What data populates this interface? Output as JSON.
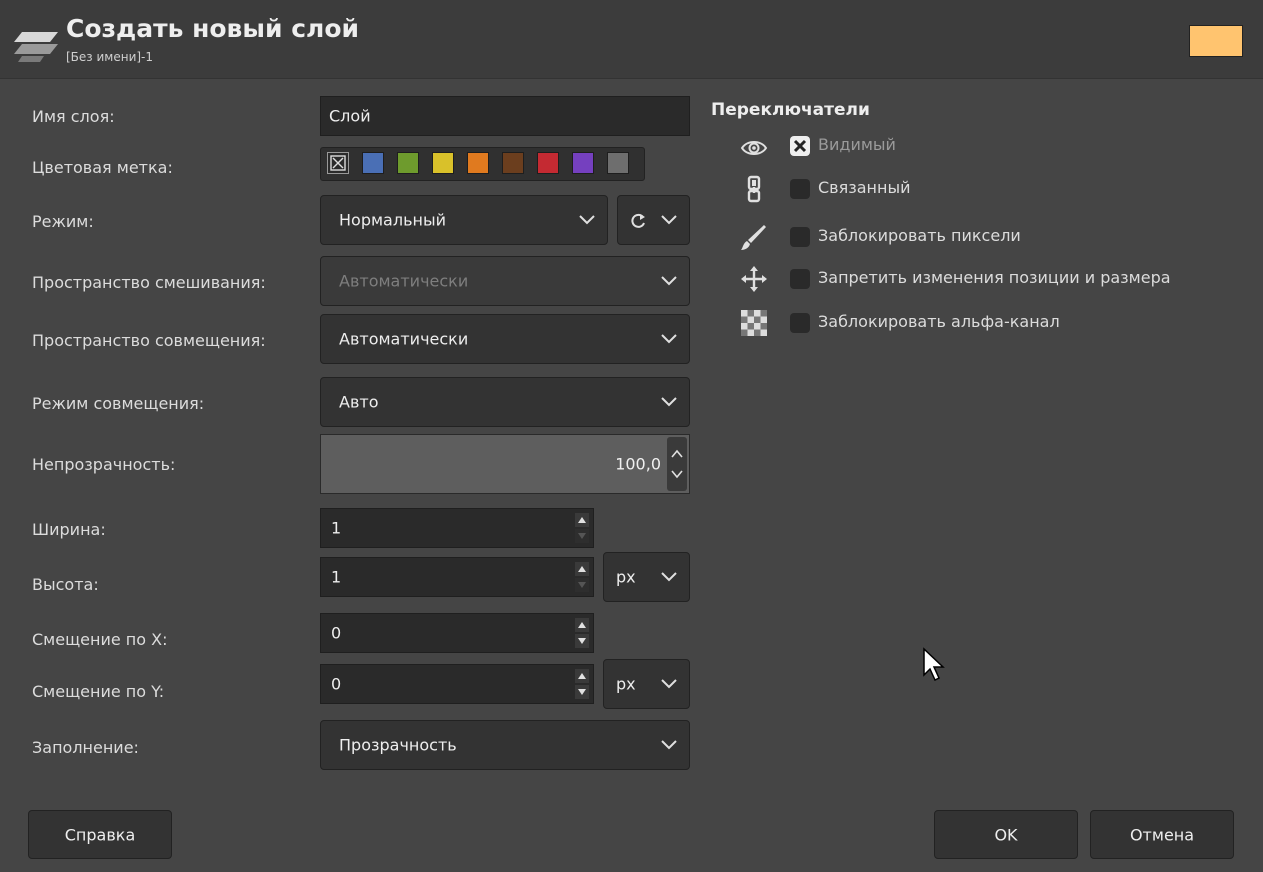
{
  "dialog": {
    "title": "Создать новый слой",
    "subtitle": "[Без имени]-1",
    "swatch_color": "#ffc46f"
  },
  "form": {
    "name_label": "Имя слоя:",
    "name_value": "Слой",
    "color_tag_label": "Цветовая метка:",
    "color_tags": [
      "none",
      "#4a6fb5",
      "#6e9b2d",
      "#d9c12a",
      "#e07a1f",
      "#6b3e1e",
      "#c42a32",
      "#7540bf",
      "#6e6e6e"
    ],
    "mode_label": "Режим:",
    "mode_value": "Нормальный",
    "blend_space_label": "Пространство смешивания:",
    "blend_space_value": "Автоматически",
    "composite_space_label": "Пространство совмещения:",
    "composite_space_value": "Автоматически",
    "composite_mode_label": "Режим совмещения:",
    "composite_mode_value": "Авто",
    "opacity_label": "Непрозрачность:",
    "opacity_value": "100,0",
    "width_label": "Ширина:",
    "width_value": "1",
    "height_label": "Высота:",
    "height_value": "1",
    "size_unit": "px",
    "offset_x_label": "Смещение по X:",
    "offset_x_value": "0",
    "offset_y_label": "Смещение по Y:",
    "offset_y_value": "0",
    "offset_unit": "px",
    "fill_label": "Заполнение:",
    "fill_value": "Прозрачность"
  },
  "switches": {
    "title": "Переключатели",
    "items": [
      {
        "icon": "eye-icon",
        "label": "Видимый",
        "checked": true
      },
      {
        "icon": "chain-icon",
        "label": "Связанный",
        "checked": false
      },
      {
        "icon": "paintbrush-icon",
        "label": "Заблокировать пиксели",
        "checked": false
      },
      {
        "icon": "move-icon",
        "label": "Запретить изменения позиции и размера",
        "checked": false
      },
      {
        "icon": "checkerboard-icon",
        "label": "Заблокировать альфа-канал",
        "checked": false
      }
    ]
  },
  "buttons": {
    "help": "Справка",
    "ok": "OK",
    "cancel": "Отмена"
  }
}
